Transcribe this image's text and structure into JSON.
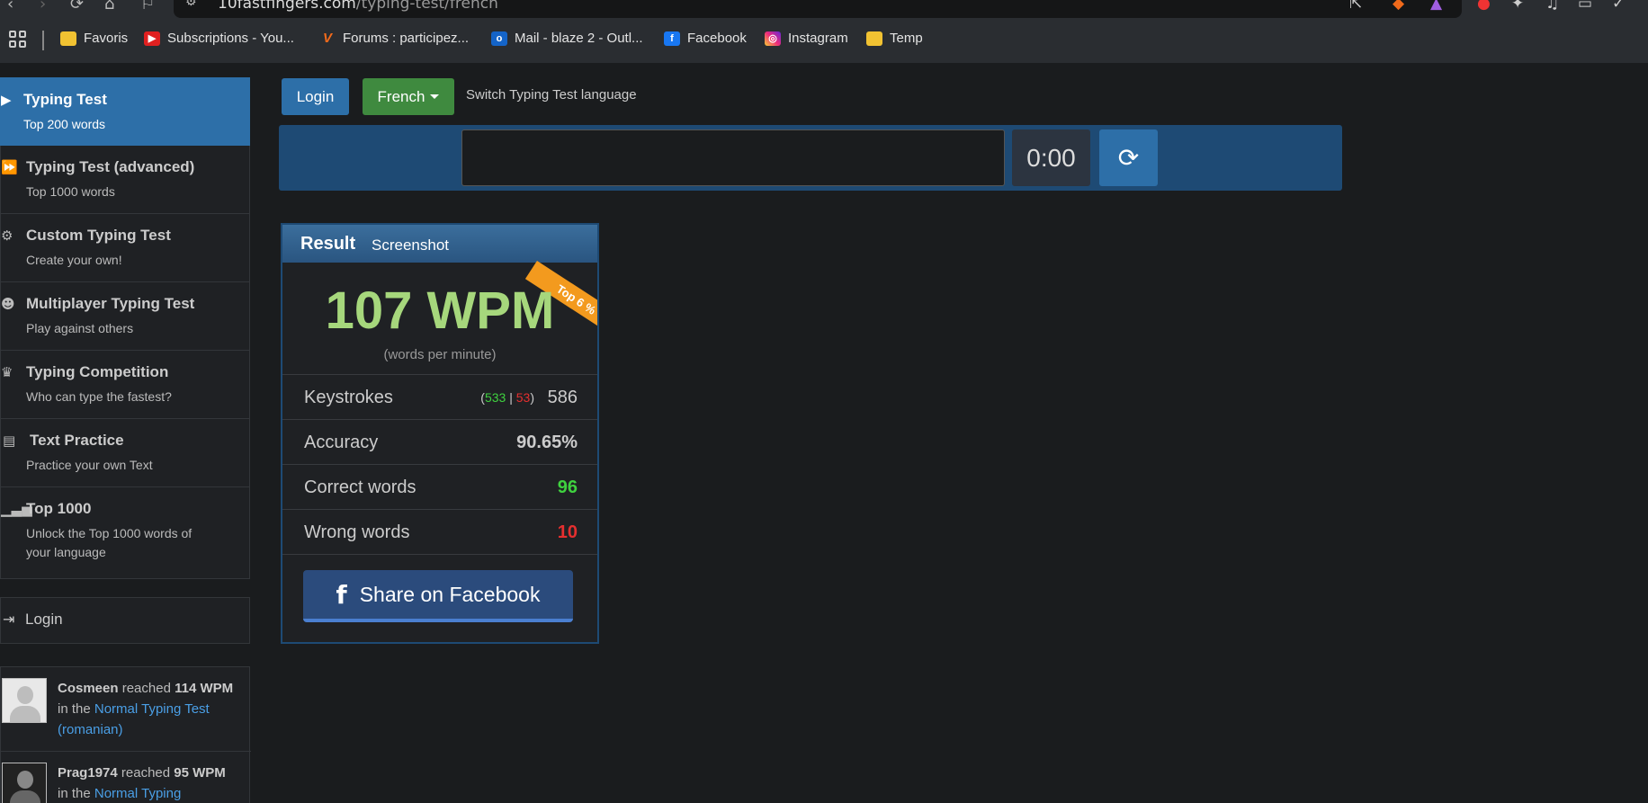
{
  "browser": {
    "url_main": "10fastfingers.com",
    "url_path": "/typing-test/french",
    "bookmarks": [
      {
        "label": "Favoris",
        "icon": "folder-icon"
      },
      {
        "label": "Subscriptions - You...",
        "icon": "youtube-icon"
      },
      {
        "label": "Forums : participez...",
        "icon": "jeuxvideo-icon"
      },
      {
        "label": "Mail - blaze 2 - Outl...",
        "icon": "outlook-icon"
      },
      {
        "label": "Facebook",
        "icon": "facebook-icon"
      },
      {
        "label": "Instagram",
        "icon": "instagram-icon"
      },
      {
        "label": "Temp",
        "icon": "folder-icon"
      }
    ]
  },
  "sidebar": {
    "items": [
      {
        "title": "Typing Test",
        "sub": "Top 200 words",
        "icon": "play-icon"
      },
      {
        "title": "Typing Test (advanced)",
        "sub": "Top 1000 words",
        "icon": "fast-forward-icon"
      },
      {
        "title": "Custom Typing Test",
        "sub": "Create your own!",
        "icon": "gears-icon"
      },
      {
        "title": "Multiplayer Typing Test",
        "sub": "Play against others",
        "icon": "users-icon"
      },
      {
        "title": "Typing Competition",
        "sub": "Who can type the fastest?",
        "icon": "trophy-icon"
      },
      {
        "title": "Text Practice",
        "sub": "Practice your own Text",
        "icon": "document-icon"
      },
      {
        "title": "Top 1000",
        "sub": "Unlock the Top 1000 words of your language",
        "icon": "signal-icon"
      }
    ],
    "login": "Login",
    "activity": [
      {
        "user": "Cosmeen",
        "reached": "reached",
        "score": "114",
        "wpm": "WPM",
        "in_the": "in the",
        "test": "Normal Typing Test (romanian)"
      },
      {
        "user": "Prag1974",
        "reached": "reached",
        "score": "95",
        "wpm": "WPM",
        "in_the": "in the",
        "test": "Normal Typing"
      }
    ]
  },
  "controls": {
    "login": "Login",
    "language": "French",
    "switch_label": "Switch Typing Test language",
    "input_value": "",
    "timer": "0:00"
  },
  "result": {
    "tab_result": "Result",
    "tab_screenshot": "Screenshot",
    "badge": "Top 6 %",
    "wpm": "107 WPM",
    "wpm_sub": "(words per minute)",
    "keystrokes_label": "Keystrokes",
    "keystrokes_correct": "533",
    "keystrokes_wrong": "53",
    "keystrokes_total": "586",
    "accuracy_label": "Accuracy",
    "accuracy": "90.65%",
    "correct_words_label": "Correct words",
    "correct_words": "96",
    "wrong_words_label": "Wrong words",
    "wrong_words": "10",
    "share": "Share on Facebook"
  }
}
